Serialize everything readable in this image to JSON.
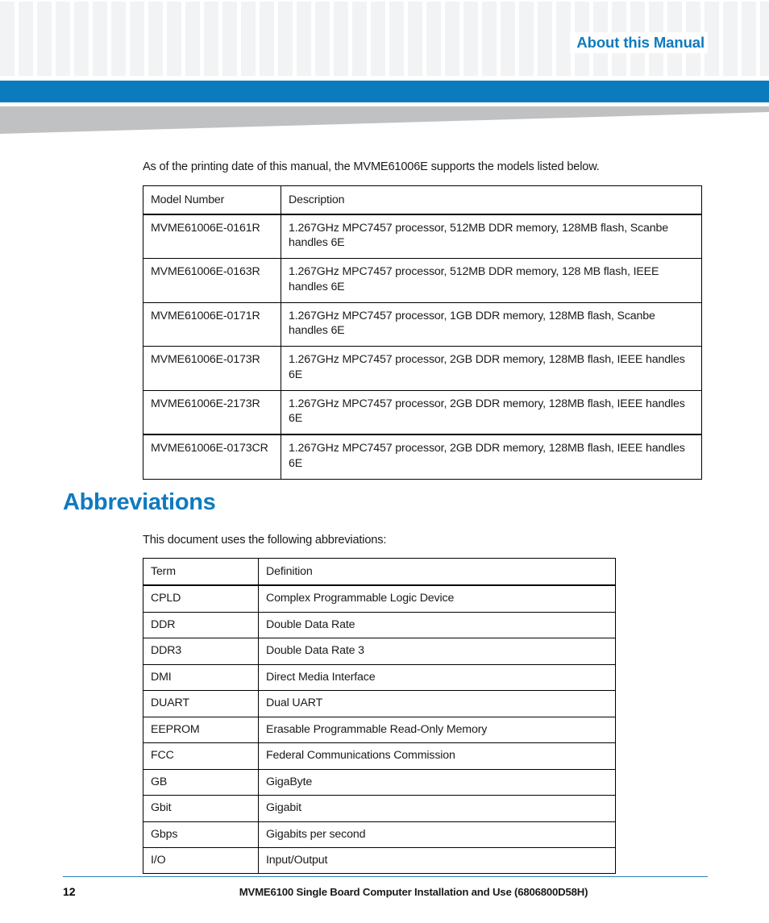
{
  "header": {
    "title": "About this Manual",
    "accent_blue": "#0a7bbd",
    "title_blue": "#0e7ac0",
    "swoosh_gray": "#bfc1c3",
    "checker_gray": "#f2f3f4"
  },
  "intro": {
    "paragraph": "As of the printing date of this manual, the MVME61006E supports the models listed below."
  },
  "models_table": {
    "headers": [
      "Model Number",
      "Description"
    ],
    "rows": [
      [
        "MVME61006E-0161R",
        "1.267GHz MPC7457 processor, 512MB DDR memory, 128MB flash, Scanbe handles 6E"
      ],
      [
        "MVME61006E-0163R",
        "1.267GHz MPC7457 processor, 512MB DDR memory, 128 MB flash, IEEE handles 6E"
      ],
      [
        "MVME61006E-0171R",
        "1.267GHz MPC7457 processor, 1GB DDR memory, 128MB flash, Scanbe handles 6E"
      ],
      [
        "MVME61006E-0173R",
        "1.267GHz MPC7457 processor, 2GB DDR memory, 128MB flash, IEEE handles 6E"
      ],
      [
        "MVME61006E-2173R",
        "1.267GHz MPC7457 processor, 2GB DDR memory, 128MB flash, IEEE handles 6E"
      ],
      [
        "MVME61006E-0173CR",
        "1.267GHz MPC7457 processor, 2GB DDR memory, 128MB flash, IEEE handles 6E"
      ]
    ]
  },
  "abbreviations_section": {
    "heading": "Abbreviations",
    "intro": "This document uses the following abbreviations:",
    "headers": [
      "Term",
      "Definition"
    ],
    "rows": [
      [
        "CPLD",
        "Complex Programmable Logic Device"
      ],
      [
        "DDR",
        "Double Data Rate"
      ],
      [
        "DDR3",
        "Double Data Rate 3"
      ],
      [
        "DMI",
        "Direct Media Interface"
      ],
      [
        "DUART",
        "Dual UART"
      ],
      [
        "EEPROM",
        "Erasable Programmable Read-Only Memory"
      ],
      [
        "FCC",
        "Federal Communications Commission"
      ],
      [
        "GB",
        "GigaByte"
      ],
      [
        "Gbit",
        "Gigabit"
      ],
      [
        "Gbps",
        "Gigabits per second"
      ],
      [
        "I/O",
        "Input/Output"
      ]
    ]
  },
  "footer": {
    "page_number": "12",
    "document_title": "MVME6100 Single Board Computer Installation and Use (6806800D58H)",
    "rule_color": "#2b7eb3"
  }
}
